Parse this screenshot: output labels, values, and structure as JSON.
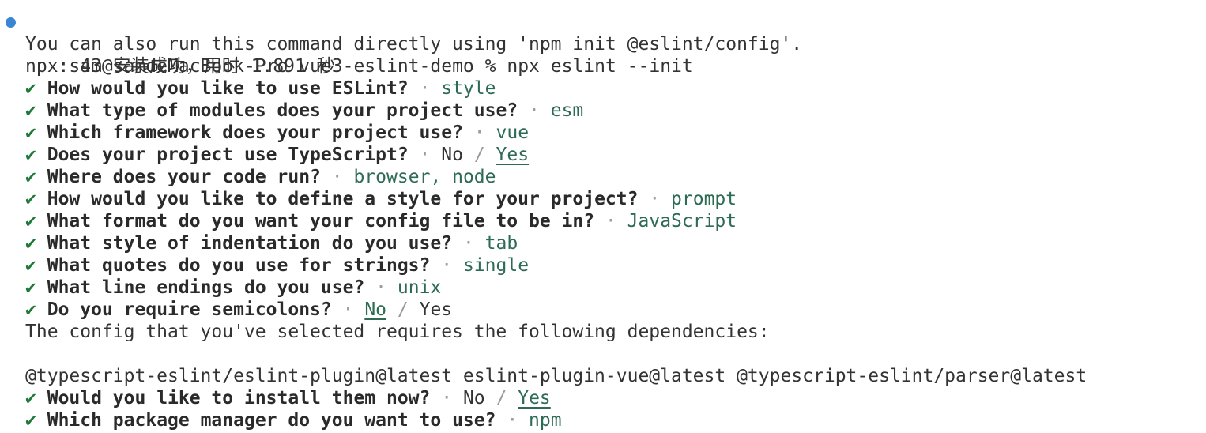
{
  "prompt": {
    "user_host": "sam@samdeMacBook-Pro",
    "cwd": "vue3-eslint-demo",
    "symbol": "%",
    "command": "npx eslint --init"
  },
  "info_lines": [
    "You can also run this command directly using 'npm init @eslint/config'.",
    "npx: 43 安装成功，用时 1.891 秒"
  ],
  "check_mark": "✔",
  "separator": "·",
  "questions": [
    {
      "q": "How would you like to use ESLint?",
      "answer": "style"
    },
    {
      "q": "What type of modules does your project use?",
      "answer": "esm"
    },
    {
      "q": "Which framework does your project use?",
      "answer": "vue"
    },
    {
      "q": "Does your project use TypeScript?",
      "choices": [
        "No",
        "/",
        "Yes"
      ],
      "selected": "Yes"
    },
    {
      "q": "Where does your code run?",
      "answer": "browser, node"
    },
    {
      "q": "How would you like to define a style for your project?",
      "answer": "prompt"
    },
    {
      "q": "What format do you want your config file to be in?",
      "answer": "JavaScript"
    },
    {
      "q": "What style of indentation do you use?",
      "answer": "tab"
    },
    {
      "q": "What quotes do you use for strings?",
      "answer": "single"
    },
    {
      "q": "What line endings do you use?",
      "answer": "unix"
    },
    {
      "q": "Do you require semicolons?",
      "choices": [
        "No",
        "/",
        "Yes"
      ],
      "selected": "No"
    }
  ],
  "deps_notice": "The config that you've selected requires the following dependencies:",
  "deps_list": "@typescript-eslint/eslint-plugin@latest eslint-plugin-vue@latest @typescript-eslint/parser@latest",
  "install_questions": [
    {
      "q": "Would you like to install them now?",
      "choices": [
        "No",
        "/",
        "Yes"
      ],
      "selected": "Yes"
    },
    {
      "q": "Which package manager do you want to use?",
      "answer": "npm"
    }
  ],
  "colors": {
    "bullet": "#3a86d4",
    "check": "#1f7a3a",
    "answer": "#2e6b55"
  }
}
